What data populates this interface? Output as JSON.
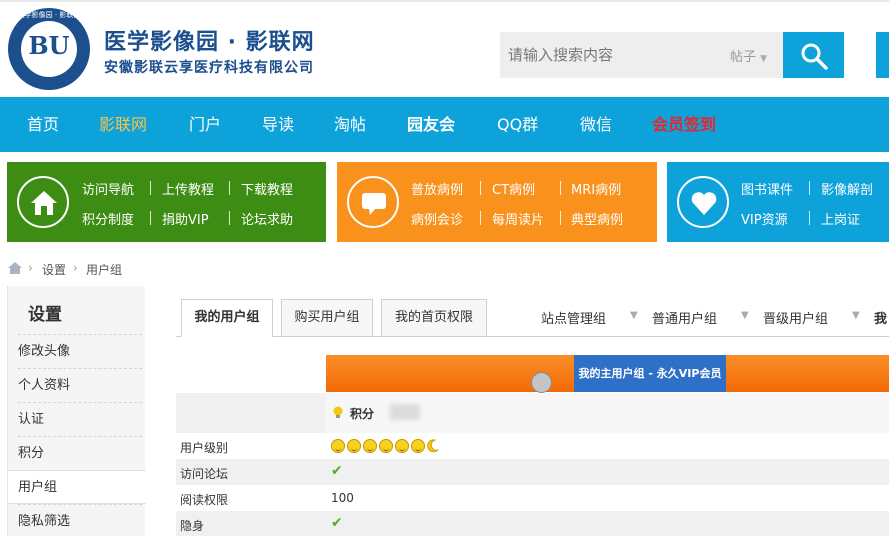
{
  "header": {
    "logo_ring_text": "医学影像园 · 影联网",
    "logo_letters": "BU",
    "site_title": "医学影像园 · 影联网",
    "site_subtitle": "安徽影联云享医疗科技有限公司",
    "search_placeholder": "请输入搜索内容",
    "search_type": "帖子"
  },
  "nav": {
    "items": [
      "首页",
      "影联网",
      "门户",
      "导读",
      "淘帖",
      "园友会",
      "QQ群",
      "微信",
      "会员签到"
    ]
  },
  "panels": {
    "green": [
      "访问导航",
      "上传教程",
      "下载教程",
      "积分制度",
      "捐助VIP",
      "论坛求助"
    ],
    "orange": [
      "普放病例",
      "CT病例",
      "MRI病例",
      "病例会诊",
      "每周读片",
      "典型病例"
    ],
    "blue": [
      "图书课件",
      "影像解剖",
      "VIP资源",
      "上岗证"
    ]
  },
  "breadcrumb": {
    "items": [
      "设置",
      "用户组"
    ]
  },
  "sidebar": {
    "title": "设置",
    "items": [
      "修改头像",
      "个人资料",
      "认证",
      "积分",
      "用户组",
      "隐私筛选"
    ]
  },
  "tabs": {
    "items": [
      "我的用户组",
      "购买用户组",
      "我的首页权限"
    ]
  },
  "groups": {
    "items": [
      "站点管理组",
      "普通用户组",
      "晋级用户组",
      "我"
    ]
  },
  "table": {
    "header_cell": "我的主用户组 - 永久VIP会员",
    "points_label": "积分",
    "rows": [
      {
        "label": "用户级别",
        "value": ""
      },
      {
        "label": "访问论坛",
        "value": "✔"
      },
      {
        "label": "阅读权限",
        "value": "100"
      },
      {
        "label": "隐身",
        "value": "✔"
      }
    ]
  },
  "colors": {
    "brand_blue": "#0ea2db",
    "green": "#3d8d14",
    "orange": "#f9921c",
    "nav_highlight": "#f6c548",
    "nav_red": "#e7262b"
  }
}
